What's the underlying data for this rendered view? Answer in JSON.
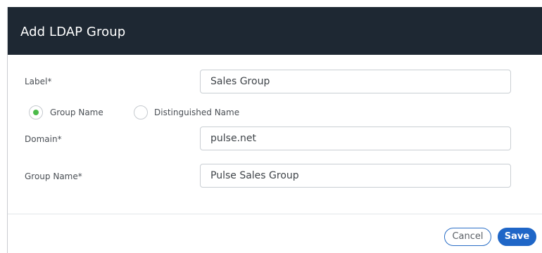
{
  "dialog": {
    "title": "Add LDAP Group"
  },
  "form": {
    "label_field": {
      "label": "Label*",
      "value": "Sales Group"
    },
    "match_type": {
      "options": [
        {
          "label": "Group Name",
          "selected": true
        },
        {
          "label": "Distinguished Name",
          "selected": false
        }
      ]
    },
    "domain_field": {
      "label": "Domain*",
      "value": "pulse.net"
    },
    "group_name_field": {
      "label": "Group Name*",
      "value": "Pulse Sales Group"
    }
  },
  "footer": {
    "cancel_label": "Cancel",
    "save_label": "Save"
  },
  "colors": {
    "header_bg": "#1e2833",
    "radio_selected": "#4cbb4a",
    "primary": "#1f66c7"
  }
}
